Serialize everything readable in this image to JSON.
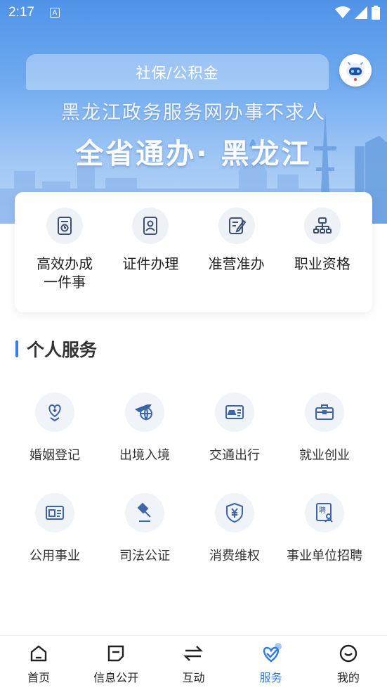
{
  "status": {
    "time": "2:17",
    "a_badge": "A"
  },
  "search": {
    "text": "社保/公积金"
  },
  "hero": {
    "subtitle": "黑龙江政务服务网办事不求人",
    "title": "全省通办· 黑龙江"
  },
  "quick": [
    {
      "label": "高效办成\n一件事",
      "icon": "document-refresh-icon"
    },
    {
      "label": "证件办理",
      "icon": "id-card-icon"
    },
    {
      "label": "准营准办",
      "icon": "edit-form-icon"
    },
    {
      "label": "职业资格",
      "icon": "org-chart-icon"
    }
  ],
  "section": {
    "title": "个人服务"
  },
  "services": [
    {
      "label": "婚姻登记",
      "icon": "marriage-icon"
    },
    {
      "label": "出境入境",
      "icon": "airplane-globe-icon"
    },
    {
      "label": "交通出行",
      "icon": "car-card-icon"
    },
    {
      "label": "就业创业",
      "icon": "briefcase-icon"
    },
    {
      "label": "公用事业",
      "icon": "utility-card-icon"
    },
    {
      "label": "司法公证",
      "icon": "gavel-icon"
    },
    {
      "label": "消费维权",
      "icon": "shield-yuan-icon"
    },
    {
      "label": "事业单位招聘",
      "icon": "hire-icon"
    }
  ],
  "nav": {
    "items": [
      {
        "label": "首页",
        "icon": "home-icon"
      },
      {
        "label": "信息公开",
        "icon": "note-icon"
      },
      {
        "label": "互动",
        "icon": "swap-icon"
      },
      {
        "label": "服务",
        "icon": "service-heart-icon",
        "active": true
      },
      {
        "label": "我的",
        "icon": "profile-smile-icon"
      }
    ]
  },
  "colors": {
    "accent": "#2f7be6",
    "icon_blue": "#3d63a8"
  }
}
